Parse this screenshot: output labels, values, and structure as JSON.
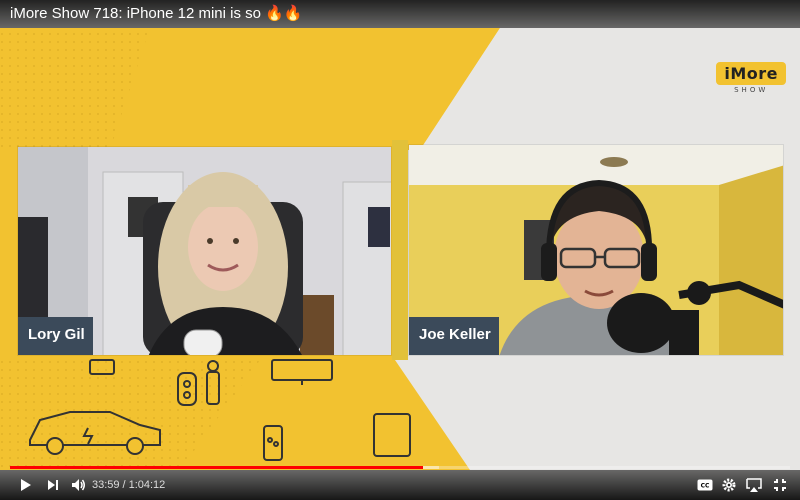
{
  "video": {
    "title": "iMore Show 718: iPhone 12 mini is so",
    "title_emoji": "🔥🔥"
  },
  "brand": {
    "name": "iMore",
    "sub": "SHOW"
  },
  "participants": [
    {
      "name": "Lory Gil"
    },
    {
      "name": "Joe Keller"
    }
  ],
  "player": {
    "current_time": "33:59",
    "duration": "1:04:12",
    "progress_fraction": 0.529,
    "buffered_fraction": 0.55,
    "accent_color": "#ff0000"
  },
  "icons": {
    "play": "play-icon",
    "next": "next-icon",
    "volume": "volume-icon",
    "captions": "captions-icon",
    "settings": "gear-icon",
    "airplay": "airplay-icon",
    "exit_fullscreen": "exit-fullscreen-icon"
  },
  "colors": {
    "yellow": "#f2c230",
    "gray": "#e7e6e4",
    "name_tag": "#3b4a5a"
  }
}
